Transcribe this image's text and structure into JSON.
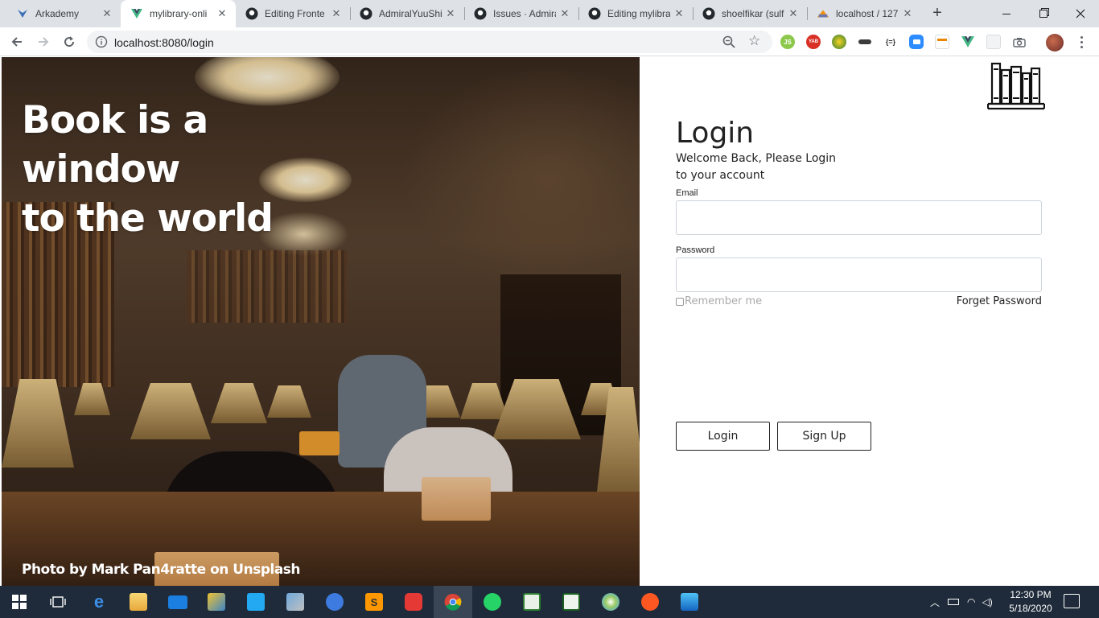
{
  "browser": {
    "tabs": [
      {
        "title": "Arkademy",
        "icon": "arkademy-favicon"
      },
      {
        "title": "mylibrary-onli",
        "icon": "vue-favicon",
        "active": true
      },
      {
        "title": "Editing Fronte",
        "icon": "github-favicon"
      },
      {
        "title": "AdmiralYuuShi",
        "icon": "github-favicon"
      },
      {
        "title": "Issues · Admira",
        "icon": "github-favicon"
      },
      {
        "title": "Editing mylibra",
        "icon": "github-favicon"
      },
      {
        "title": "shoelfikar (sulf",
        "icon": "github-favicon"
      },
      {
        "title": "localhost / 127",
        "icon": "phpmyadmin-favicon"
      }
    ],
    "new_tab": "+",
    "close_glyph": "✕",
    "url": "localhost:8080/login",
    "extensions": [
      {
        "name": "nodejs-ext",
        "label": "JS",
        "color": "#8cc84b"
      },
      {
        "name": "yab-ext",
        "label": "YAB",
        "color": "#d93025"
      },
      {
        "name": "globe-ext",
        "label": "",
        "color": "#2e7d32"
      },
      {
        "name": "mask-ext",
        "label": "",
        "color": "#3c3c3c"
      },
      {
        "name": "json-ext",
        "label": "{=}",
        "color": "#ffffff"
      },
      {
        "name": "zoom-ext",
        "label": "",
        "color": "#2d8cff"
      },
      {
        "name": "calendar-ext",
        "label": "",
        "color": "#e8eaed"
      },
      {
        "name": "vue-devtools-ext",
        "label": "",
        "color": "#41b883"
      },
      {
        "name": "grid-ext",
        "label": "",
        "color": "#dadce0"
      },
      {
        "name": "camera-ext",
        "label": "",
        "color": "#5f6368"
      }
    ]
  },
  "hero": {
    "title_line1": "Book is a window",
    "title_line2": "to the world",
    "credit": "Photo by Mark Pan4ratte on Unsplash"
  },
  "login": {
    "title": "Login",
    "subtitle_line1": "Welcome Back, Please Login",
    "subtitle_line2": "to your account",
    "email_label": "Email",
    "email_value": "",
    "password_label": "Password",
    "password_value": "",
    "remember_label": "Remember me",
    "forget_label": "Forget Password",
    "login_button": "Login",
    "signup_button": "Sign Up"
  },
  "taskbar": {
    "apps": [
      "task-view-icon",
      "edge-icon",
      "file-explorer-icon",
      "mail-icon",
      "network-app-icon",
      "vscode-icon",
      "remote-desktop-icon",
      "app-circle-icon",
      "sublime-icon",
      "game-icon",
      "chrome-icon",
      "whatsapp-icon",
      "text-editor-icon",
      "notepad-icon",
      "paint-icon",
      "brush-icon",
      "photos-icon"
    ],
    "time": "12:30 PM",
    "date": "5/18/2020"
  }
}
